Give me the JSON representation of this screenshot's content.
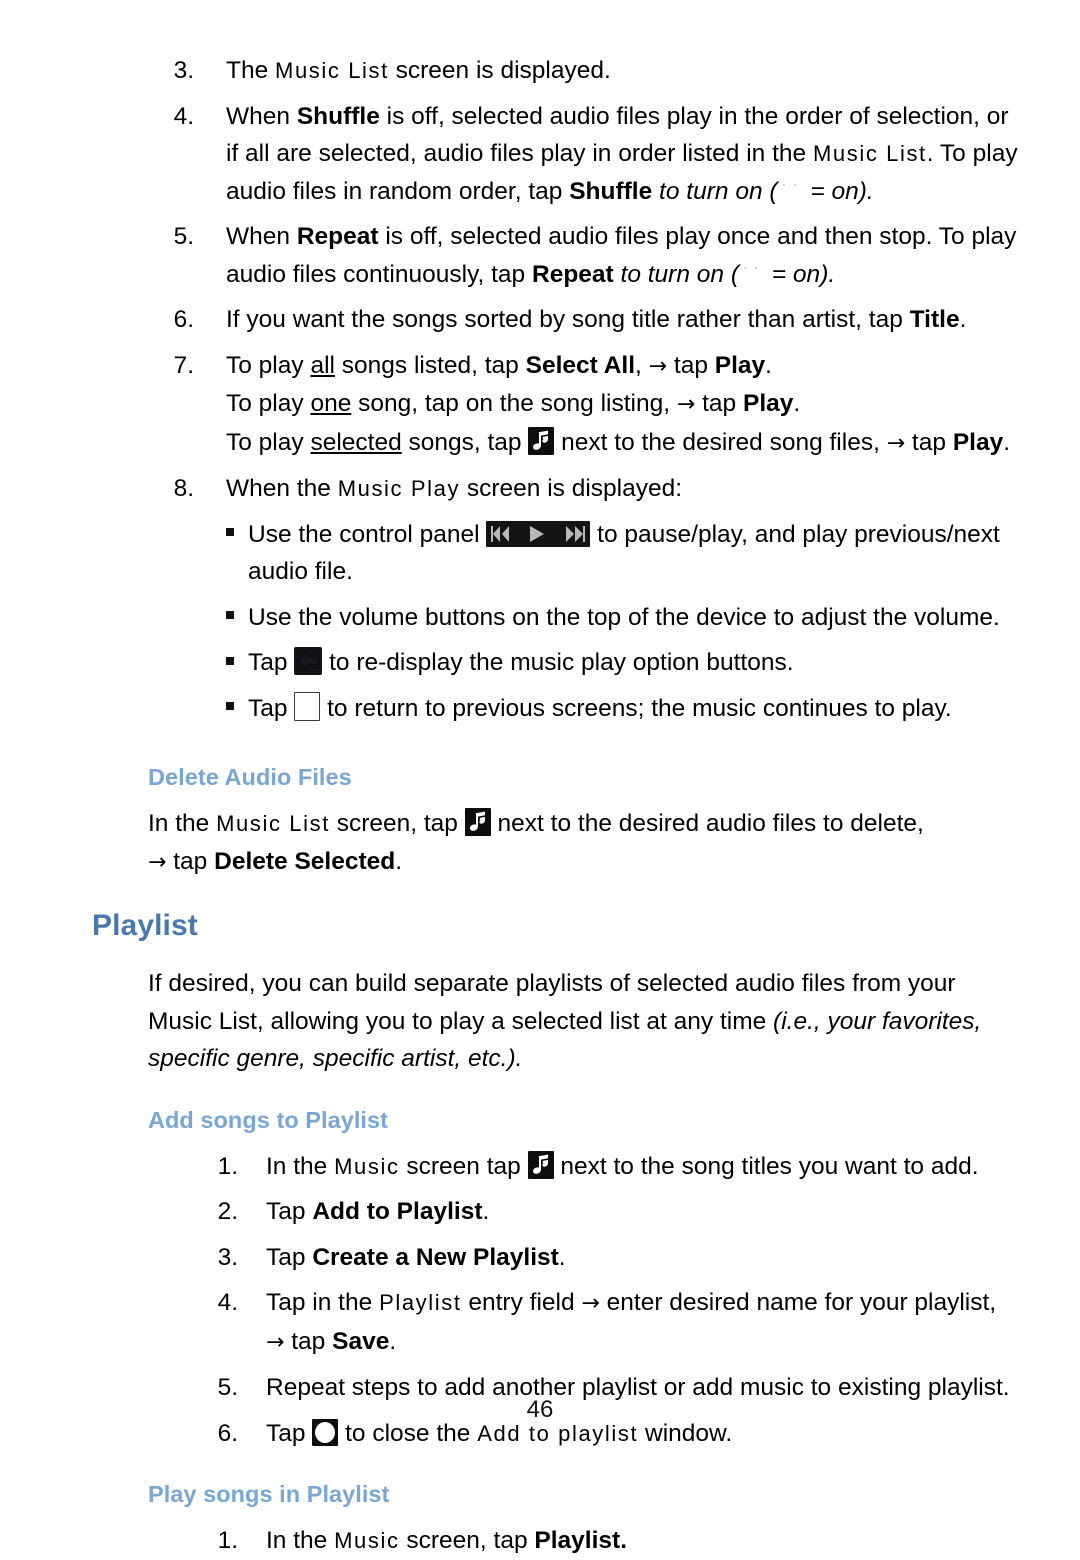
{
  "page": {
    "number": "46",
    "heading_color": "#4a78ad",
    "subheading_color": "#7aa6d6"
  },
  "steps": {
    "s3": {
      "number": "3.",
      "pre": "The ",
      "screen": "Music List",
      "post": " screen is displayed."
    },
    "s4": {
      "number": "4.",
      "t1": "When ",
      "b1": "Shuffle",
      "t2": " is off, selected audio files play in the order of selection, or if all are selected, audio files play in order listed in the ",
      "screen": "Music List",
      "t3": ". To play audio files in random order, tap ",
      "b2": "Shuffle",
      "t4": " to turn on (",
      "t5": " = on",
      "t6": ")."
    },
    "s5": {
      "number": "5.",
      "t1": "When ",
      "b1": "Repeat",
      "t2": " is off, selected audio files play once and then stop. To play audio files continuously, tap ",
      "b2": "Repeat",
      "t3": " to turn on (",
      "t4": " = on",
      "t5": ")."
    },
    "s6": {
      "number": "6.",
      "t1": "If you want the songs sorted by song title rather than artist, tap ",
      "b1": "Title",
      "t2": "."
    },
    "s7": {
      "number": "7.",
      "line1": {
        "t1": "To play ",
        "u1": "all",
        "t2": " songs listed, tap ",
        "b1": "Select All",
        "t3": ", ",
        "arrow": "→",
        "t4": " tap ",
        "b2": "Play",
        "t5": "."
      },
      "line2": {
        "t1": "To play ",
        "u1": "one",
        "t2": " song, tap on the song listing, ",
        "arrow": "→",
        "t3": " tap ",
        "b1": "Play",
        "t4": "."
      },
      "line3": {
        "t1": "To play ",
        "u1": "selected",
        "t2": " songs, tap ",
        "t3": " next to the desired song files, ",
        "arrow": "→",
        "t4": " tap ",
        "b1": "Play",
        "t5": "."
      }
    },
    "s8": {
      "number": "8.",
      "t1": "When the ",
      "screen": "Music Play",
      "t2": " screen is displayed:",
      "bullets": [
        {
          "t1": "Use the control panel ",
          "t2": " to pause/play, and play previous/next audio file.",
          "icon": "media-controls-icon"
        },
        {
          "t1": "Use the volume buttons on the top of the device to adjust the volume.",
          "t2": "",
          "icon": ""
        },
        {
          "t1": "Tap ",
          "t2": " to re-display the music play option buttons.",
          "icon": "back-arrow-icon"
        },
        {
          "t1": "Tap ",
          "t2": " to return to previous screens; the music continues to play.",
          "icon": "window-icon"
        }
      ]
    }
  },
  "delete_audio_files": {
    "heading": "Delete Audio Files",
    "t1": "In the ",
    "screen": "Music List",
    "t2": " screen, tap ",
    "t3": " next to the desired audio files to delete,",
    "arrow": "→",
    "t4": " tap ",
    "b1": "Delete Selected",
    "t5": "."
  },
  "playlist": {
    "heading": "Playlist",
    "intro": {
      "t1": "If desired, you can build separate playlists of selected audio files from your Music List, allowing you to play a selected list at any time ",
      "i1": "(i.e., your favorites, specific genre, specific artist, etc.)",
      "t2": "."
    },
    "add_songs": {
      "heading": "Add songs to Playlist",
      "steps": [
        {
          "number": "1.",
          "t1": "In the ",
          "screen": "Music",
          "t2": " screen tap ",
          "t3": " next to the song titles you want to add.",
          "icon": "music-note-icon"
        },
        {
          "number": "2.",
          "t1": "Tap ",
          "b1": "Add to Playlist",
          "t2": "."
        },
        {
          "number": "3.",
          "t1": "Tap ",
          "b1": "Create a New Playlist",
          "t2": "."
        },
        {
          "number": "4.",
          "t1": "Tap in the ",
          "screen": "Playlist",
          "t2": " entry field ",
          "arrow": "→",
          "t3": " enter desired name for your playlist,",
          "arrow2": "→",
          "t4": " tap ",
          "b1": "Save",
          "t5": "."
        },
        {
          "number": "5.",
          "t1": "Repeat steps to add another playlist or add music to existing playlist."
        },
        {
          "number": "6.",
          "t1": "Tap ",
          "t2": " to close the ",
          "screen": "Add to playlist",
          "t3": " window.",
          "icon": "close-icon"
        }
      ]
    },
    "play_songs": {
      "heading": "Play songs in Playlist",
      "steps": [
        {
          "number": "1.",
          "t1": "In the ",
          "screen": "Music",
          "t2": " screen, tap ",
          "b1": "Playlist."
        }
      ]
    }
  }
}
